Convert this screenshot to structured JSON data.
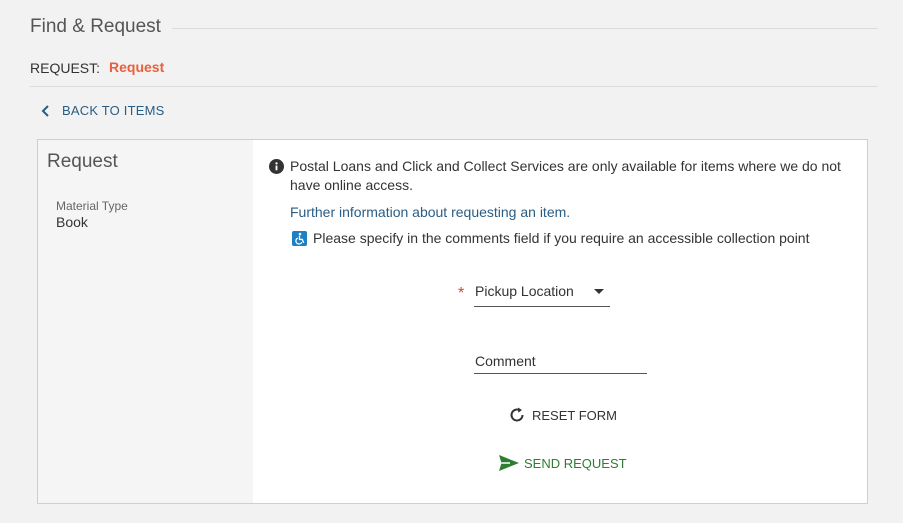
{
  "header": {
    "title": "Find & Request"
  },
  "request_row": {
    "label": "REQUEST:",
    "value": "Request"
  },
  "back_link": {
    "label": "BACK TO ITEMS"
  },
  "card": {
    "title": "Request",
    "material_type_label": "Material Type",
    "material_type_value": "Book"
  },
  "notice": {
    "text": "Postal Loans and Click and Collect Services are only available for items where we do not have online access.",
    "link": "Further information about requesting an item.",
    "accessibility": "Please specify in the comments field if you require an accessible collection point"
  },
  "form": {
    "required_marker": "*",
    "pickup_label": "Pickup Location",
    "comment_label": "Comment",
    "reset_label": "RESET FORM",
    "send_label": "SEND REQUEST"
  },
  "colors": {
    "accent": "#e8603c",
    "link": "#2a5d84",
    "send": "#2e7d32",
    "required": "#d9412e",
    "accessibility_icon": "#1e7fc2"
  },
  "icons": {
    "back": "chevron-left-icon",
    "info": "info-icon",
    "accessibility": "accessibility-icon",
    "reset": "refresh-icon",
    "send": "send-icon"
  }
}
